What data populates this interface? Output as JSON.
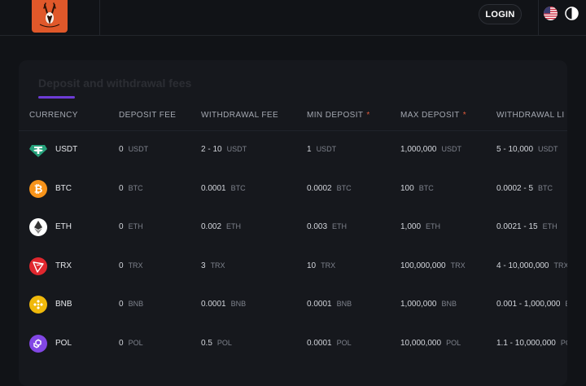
{
  "header": {
    "login_label": "LOGIN",
    "language_flag": "us-flag-icon",
    "theme_icon": "half-circle-theme-icon"
  },
  "card": {
    "title": "Deposit and withdrawal fees",
    "columns": [
      "CURRENCY",
      "DEPOSIT FEE",
      "WITHDRAWAL FEE",
      "MIN DEPOSIT",
      "MAX DEPOSIT",
      "WITHDRAWAL LI"
    ],
    "required_marker": "*",
    "rows": [
      {
        "currency": "USDT",
        "icon": "tether-icon",
        "color": "#26a17b",
        "deposit_fee": "0",
        "withdrawal_fee": "2 - 10",
        "min_deposit": "1",
        "max_deposit": "1,000,000",
        "withdrawal_limit": "5 - 10,000",
        "unit": "USDT"
      },
      {
        "currency": "BTC",
        "icon": "bitcoin-icon",
        "color": "#f7931a",
        "deposit_fee": "0",
        "withdrawal_fee": "0.0001",
        "min_deposit": "0.0002",
        "max_deposit": "100",
        "withdrawal_limit": "0.0002 - 5",
        "unit": "BTC"
      },
      {
        "currency": "ETH",
        "icon": "ethereum-icon",
        "color": "#ffffff",
        "deposit_fee": "0",
        "withdrawal_fee": "0.002",
        "min_deposit": "0.003",
        "max_deposit": "1,000",
        "withdrawal_limit": "0.0021 - 15",
        "unit": "ETH"
      },
      {
        "currency": "TRX",
        "icon": "tron-icon",
        "color": "#e0272e",
        "deposit_fee": "0",
        "withdrawal_fee": "3",
        "min_deposit": "10",
        "max_deposit": "100,000,000",
        "withdrawal_limit": "4 - 10,000,000",
        "unit": "TRX"
      },
      {
        "currency": "BNB",
        "icon": "bnb-icon",
        "color": "#f0b90b",
        "deposit_fee": "0",
        "withdrawal_fee": "0.0001",
        "min_deposit": "0.0001",
        "max_deposit": "1,000,000",
        "withdrawal_limit": "0.001 - 1,000,000",
        "unit": "BNB"
      },
      {
        "currency": "POL",
        "icon": "polygon-icon",
        "color": "#8247e5",
        "deposit_fee": "0",
        "withdrawal_fee": "0.5",
        "min_deposit": "0.0001",
        "max_deposit": "10,000,000",
        "withdrawal_limit": "1.1 - 10,000,000",
        "unit": "POL"
      }
    ]
  }
}
